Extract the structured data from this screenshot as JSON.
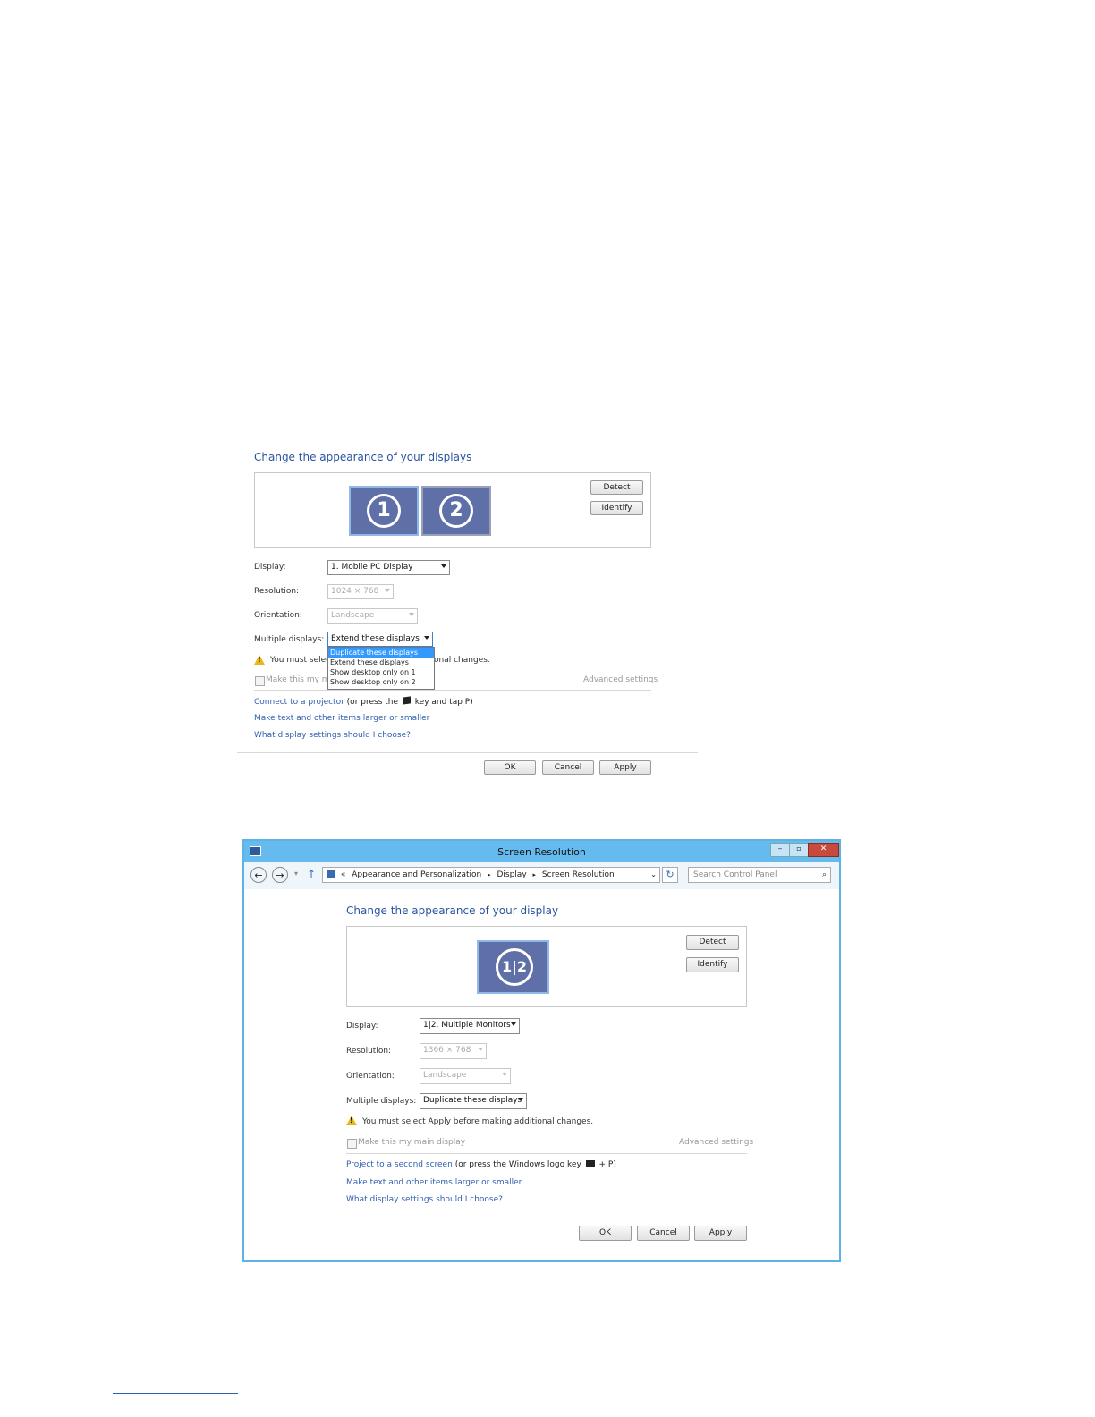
{
  "top": {
    "heading": "Change the appearance of your displays",
    "detect": "Detect",
    "identify": "Identify",
    "monitors": [
      "1",
      "2"
    ],
    "display_label": "Display:",
    "display_value": "1. Mobile PC Display",
    "resolution_label": "Resolution:",
    "resolution_value": "1024 × 768",
    "orientation_label": "Orientation:",
    "orientation_value": "Landscape",
    "multiple_label": "Multiple displays:",
    "multiple_value": "Extend these displays",
    "dropdown_options": [
      "Duplicate these displays",
      "Extend these displays",
      "Show desktop only on 1",
      "Show desktop only on 2"
    ],
    "warning_left": "You must select",
    "warning_right": "onal changes.",
    "make_main": "Make this my m",
    "advanced": "Advanced settings",
    "connect_link": "Connect to a projector",
    "connect_suffix_a": "(or press the",
    "connect_suffix_b": "key and tap P)",
    "link2": "Make text and other items larger or smaller",
    "link3": "What display settings should I choose?",
    "ok": "OK",
    "cancel": "Cancel",
    "apply": "Apply"
  },
  "window": {
    "title": "Screen Resolution",
    "breadcrumb": [
      "Appearance and Personalization",
      "Display",
      "Screen Resolution"
    ],
    "breadcrumb_prefix": "«",
    "search_placeholder": "Search Control Panel",
    "heading": "Change the appearance of your display",
    "detect": "Detect",
    "identify": "Identify",
    "monitor_label": "1|2",
    "display_label": "Display:",
    "display_value": "1|2. Multiple Monitors",
    "resolution_label": "Resolution:",
    "resolution_value": "1366 × 768",
    "orientation_label": "Orientation:",
    "orientation_value": "Landscape",
    "multiple_label": "Multiple displays:",
    "multiple_value": "Duplicate these displays",
    "warning": "You must select Apply before making additional changes.",
    "make_main": "Make this my main display",
    "advanced": "Advanced settings",
    "project_link": "Project to a second screen",
    "project_suffix_a": "(or press the Windows logo key",
    "project_suffix_b": "+ P)",
    "link2": "Make text and other items larger or smaller",
    "link3": "What display settings should I choose?",
    "ok": "OK",
    "cancel": "Cancel",
    "apply": "Apply"
  }
}
